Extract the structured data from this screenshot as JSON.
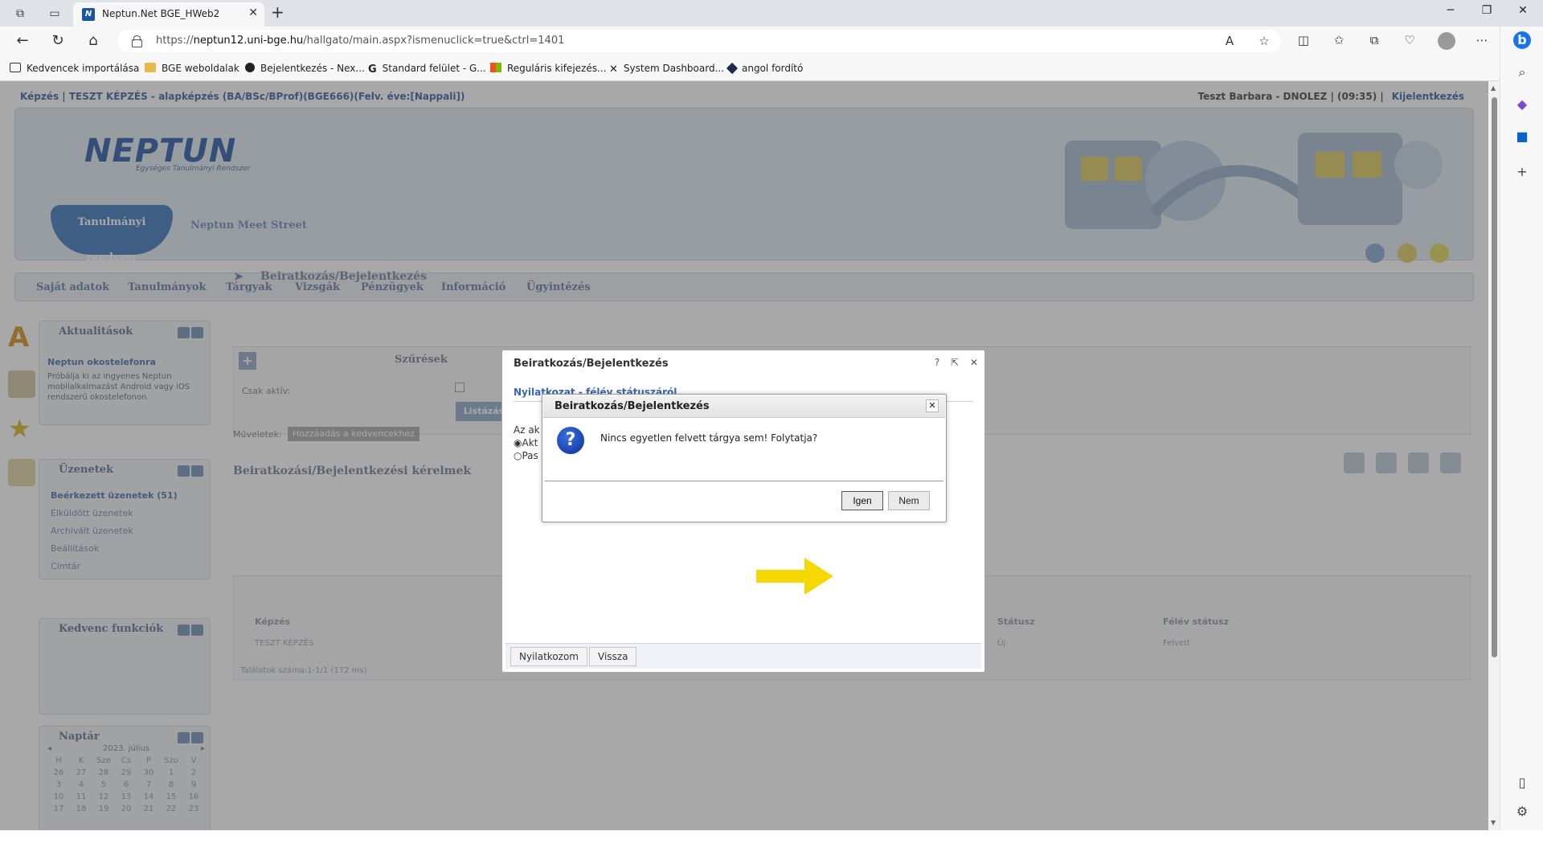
{
  "browser": {
    "tab_title": "Neptun.Net BGE_HWeb2",
    "tab_favicon": "N",
    "url_prefix": "https://",
    "url_host": "neptun12.uni-bge.hu",
    "url_path": "/hallgato/main.aspx?ismenuclick=true&ctrl=1401",
    "bookmarks": [
      {
        "label": "Kedvencek importálása",
        "icon": "import-icon"
      },
      {
        "label": "BGE weboldalak",
        "icon": "folder-icon"
      },
      {
        "label": "Bejelentkezés - Nex...",
        "icon": "nexon-icon"
      },
      {
        "label": "Standard felület - G...",
        "icon": "g-icon"
      },
      {
        "label": "Reguláris kifejezés...",
        "icon": "microsoft-icon"
      },
      {
        "label": "System Dashboard...",
        "icon": "dashboard-icon"
      },
      {
        "label": "angol fordító",
        "icon": "translate-icon"
      }
    ]
  },
  "page": {
    "topline": "Képzés | TESZT KÉPZÉS - alapképzés (BA/BSc/BProf)(BGE666)(Felv. éve:[Nappali])",
    "user": "Teszt Barbara - DNOLEZ | (09:35) |",
    "logout": "Kijelentkezés",
    "logo": "NEPTUN",
    "logo_sub": "Egységes Tanulmányi Rendszer",
    "system_tab": "Tanulmányi rendszer",
    "meet_street": "Neptun Meet Street",
    "menu": [
      "Saját adatok",
      "Tanulmányok",
      "Tárgyak",
      "Vizsgák",
      "Pénzügyek",
      "Információ",
      "Ügyintézés"
    ],
    "boxes": {
      "aktualitasok": {
        "title": "Aktualitások",
        "link": "Neptun okostelefonra",
        "text": "Próbálja ki az ingyenes Neptun mobilalkalmazást Android vagy iOS rendszerű okostelefonon."
      },
      "uzenetek": {
        "title": "Üzenetek",
        "items": [
          "Beérkezett üzenetek (51)",
          "Elküldött üzenetek",
          "Archivált üzenetek",
          "Beállítások",
          "Címtár"
        ]
      },
      "kedvenc": {
        "title": "Kedvenc funkciók"
      },
      "naptar": {
        "title": "Naptár",
        "month": "2023. július",
        "weekdays": [
          "H",
          "K",
          "Sze",
          "Cs",
          "P",
          "Szo",
          "V"
        ],
        "days": [
          "26",
          "27",
          "28",
          "29",
          "30",
          "1",
          "2",
          "3",
          "4",
          "5",
          "6",
          "7",
          "8",
          "9",
          "10",
          "11",
          "12",
          "13",
          "14",
          "15",
          "16",
          "17",
          "18",
          "19",
          "20",
          "21",
          "22",
          "23"
        ]
      }
    },
    "main_title": "Beiratkozás/Bejelentkezés",
    "filter_title": "Szűrések",
    "filter_label": "Csak aktív:",
    "filter_button": "Listázás",
    "actions_label": "Műveletek:",
    "actions_button": "Hozzáadás a kedvencekhez",
    "section_title": "Beiratkozási/Bejelentkezési kérelmek",
    "grid": {
      "headers": [
        "Képzés",
        "Státusz",
        "Félév státusz"
      ],
      "row": [
        "TESZT KÉPZÉS",
        "Új",
        "Felvett"
      ],
      "footer": "Találatok száma:1-1/1 (172 ms)"
    }
  },
  "outer_dialog": {
    "title": "Beiratkozás/Bejelentkezés",
    "ctrls": [
      "?",
      "⇱",
      "✕"
    ],
    "link": "Nyilatkozat - félév státuszáról",
    "text": "Az ak",
    "radio_active": "Akt",
    "radio_passive": "Pas",
    "button_declare": "Nyilatkozom",
    "button_back": "Vissza"
  },
  "inner_dialog": {
    "title": "Beiratkozás/Bejelentkezés",
    "message": "Nincs egyetlen felvett tárgya sem! Folytatja?",
    "yes": "Igen",
    "no": "Nem",
    "close": "✕",
    "icon": "question-icon"
  },
  "colors": {
    "arrow": "#f5d800",
    "accent": "#3a66b0"
  }
}
